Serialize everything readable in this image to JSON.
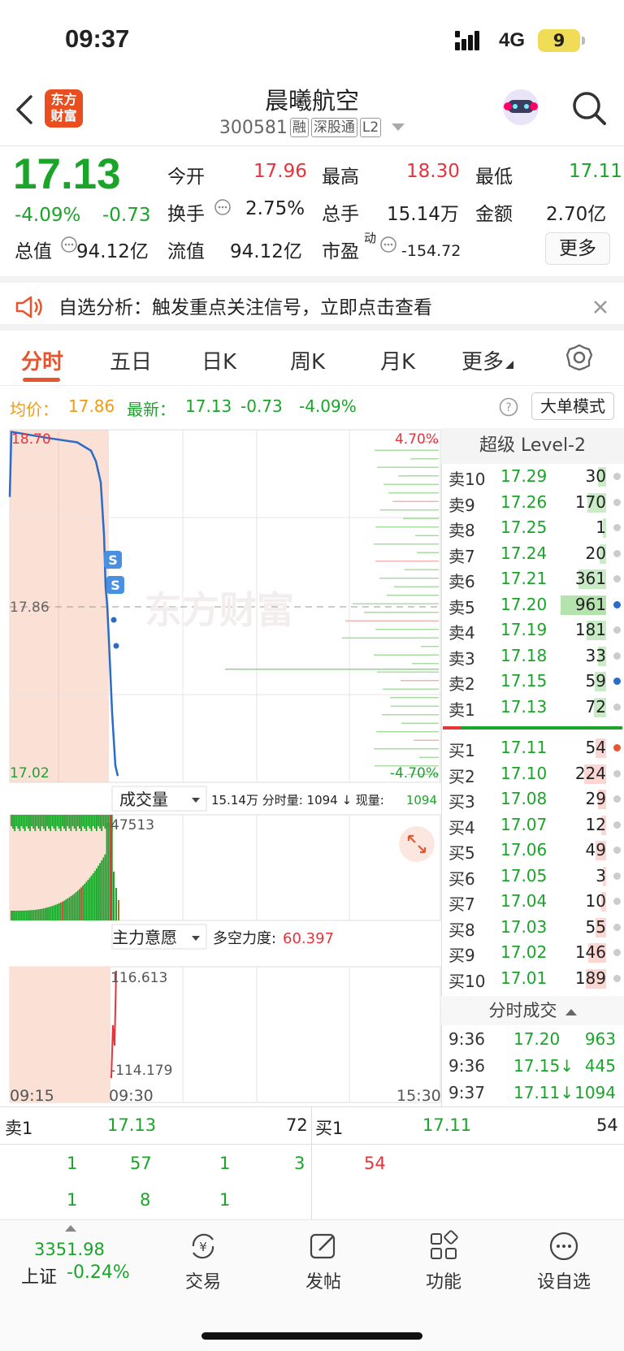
{
  "status": {
    "time": "09:37",
    "network": "4G",
    "battery": "9"
  },
  "header": {
    "name": "晨曦航空",
    "code": "300581",
    "tags": [
      "融",
      "深股通",
      "L2"
    ],
    "logo": "东方财富"
  },
  "quote": {
    "price": "17.13",
    "pct": "-4.09%",
    "chg": "-0.73",
    "open_label": "今开",
    "open": "17.96",
    "high_label": "最高",
    "high": "18.30",
    "low_label": "最低",
    "low": "17.11",
    "turn_label": "换手",
    "turn": "2.75%",
    "vol_label": "总手",
    "vol": "15.14万",
    "amt_label": "金额",
    "amt": "2.70亿",
    "mcap_label": "总值",
    "mcap": "94.12亿",
    "float_label": "流值",
    "float": "94.12亿",
    "pe_label": "市盈",
    "pe_sup": "动",
    "pe": "-154.72",
    "more": "更多"
  },
  "alert": {
    "text": "自选分析：触发重点关注信号，立即点击查看"
  },
  "tabs": [
    "分时",
    "五日",
    "日K",
    "周K",
    "月K",
    "更多"
  ],
  "avg_row": {
    "avg_label": "均价：",
    "avg": "17.86",
    "latest_label": "最新：",
    "latest": "17.13",
    "chg": "-0.73",
    "pct": "-4.09%",
    "mode": "大单模式"
  },
  "chart": {
    "price_high": "18.70",
    "price_low": "17.02",
    "pct_high": "4.70%",
    "pct_low": "-4.70%",
    "mid": "17.86",
    "watermark": "东方财富",
    "vol_label": "成交量",
    "vol_info": "15.14万  分时量: 1094 ↓ 现量: ",
    "vol_now": "1094",
    "vol_max": "47513",
    "ind_label": "主力意愿",
    "ind_info": "多空力度:",
    "ind_value": "60.397",
    "ind_high": "116.613",
    "ind_low": "-114.179",
    "t_start": "09:15",
    "t_mid": "09:30",
    "t_end": "15:30",
    "price_line": [
      18.38,
      18.69,
      18.68,
      18.66,
      18.64,
      18.6,
      18.55,
      18.45,
      18.2,
      17.95,
      17.86,
      17.7,
      17.35,
      17.1,
      17.05
    ]
  },
  "level2": {
    "title": "超级 Level-2",
    "sells": [
      [
        "卖10",
        "17.29",
        "30"
      ],
      [
        "卖9",
        "17.26",
        "170"
      ],
      [
        "卖8",
        "17.25",
        "1"
      ],
      [
        "卖7",
        "17.24",
        "20"
      ],
      [
        "卖6",
        "17.21",
        "361"
      ],
      [
        "卖5",
        "17.20",
        "961"
      ],
      [
        "卖4",
        "17.19",
        "181"
      ],
      [
        "卖3",
        "17.18",
        "33"
      ],
      [
        "卖2",
        "17.15",
        "59"
      ],
      [
        "卖1",
        "17.13",
        "72"
      ]
    ],
    "buys": [
      [
        "买1",
        "17.11",
        "54"
      ],
      [
        "买2",
        "17.10",
        "224"
      ],
      [
        "买3",
        "17.08",
        "29"
      ],
      [
        "买4",
        "17.07",
        "12"
      ],
      [
        "买5",
        "17.06",
        "49"
      ],
      [
        "买6",
        "17.05",
        "3"
      ],
      [
        "买7",
        "17.04",
        "10"
      ],
      [
        "买8",
        "17.03",
        "55"
      ],
      [
        "买9",
        "17.02",
        "146"
      ],
      [
        "买10",
        "17.01",
        "189"
      ]
    ],
    "ticks_title": "分时成交",
    "ticks": [
      [
        "9:36",
        "17.20",
        "963"
      ],
      [
        "9:36",
        "17.15↓",
        "445"
      ],
      [
        "9:37",
        "17.11↓",
        "1094"
      ]
    ]
  },
  "queue": {
    "sell_label": "卖1",
    "sell_price": "17.13",
    "sell_vol": "72",
    "buy_label": "买1",
    "buy_price": "17.11",
    "buy_vol": "54",
    "sell_orders": [
      "1",
      "57",
      "1",
      "3",
      "1",
      "8",
      "1"
    ],
    "buy_orders": [
      "54"
    ]
  },
  "nav": {
    "index_value": "3351.98",
    "index_name": "上证",
    "index_pct": "-0.24%",
    "items": [
      "交易",
      "发帖",
      "功能",
      "设自选"
    ]
  }
}
